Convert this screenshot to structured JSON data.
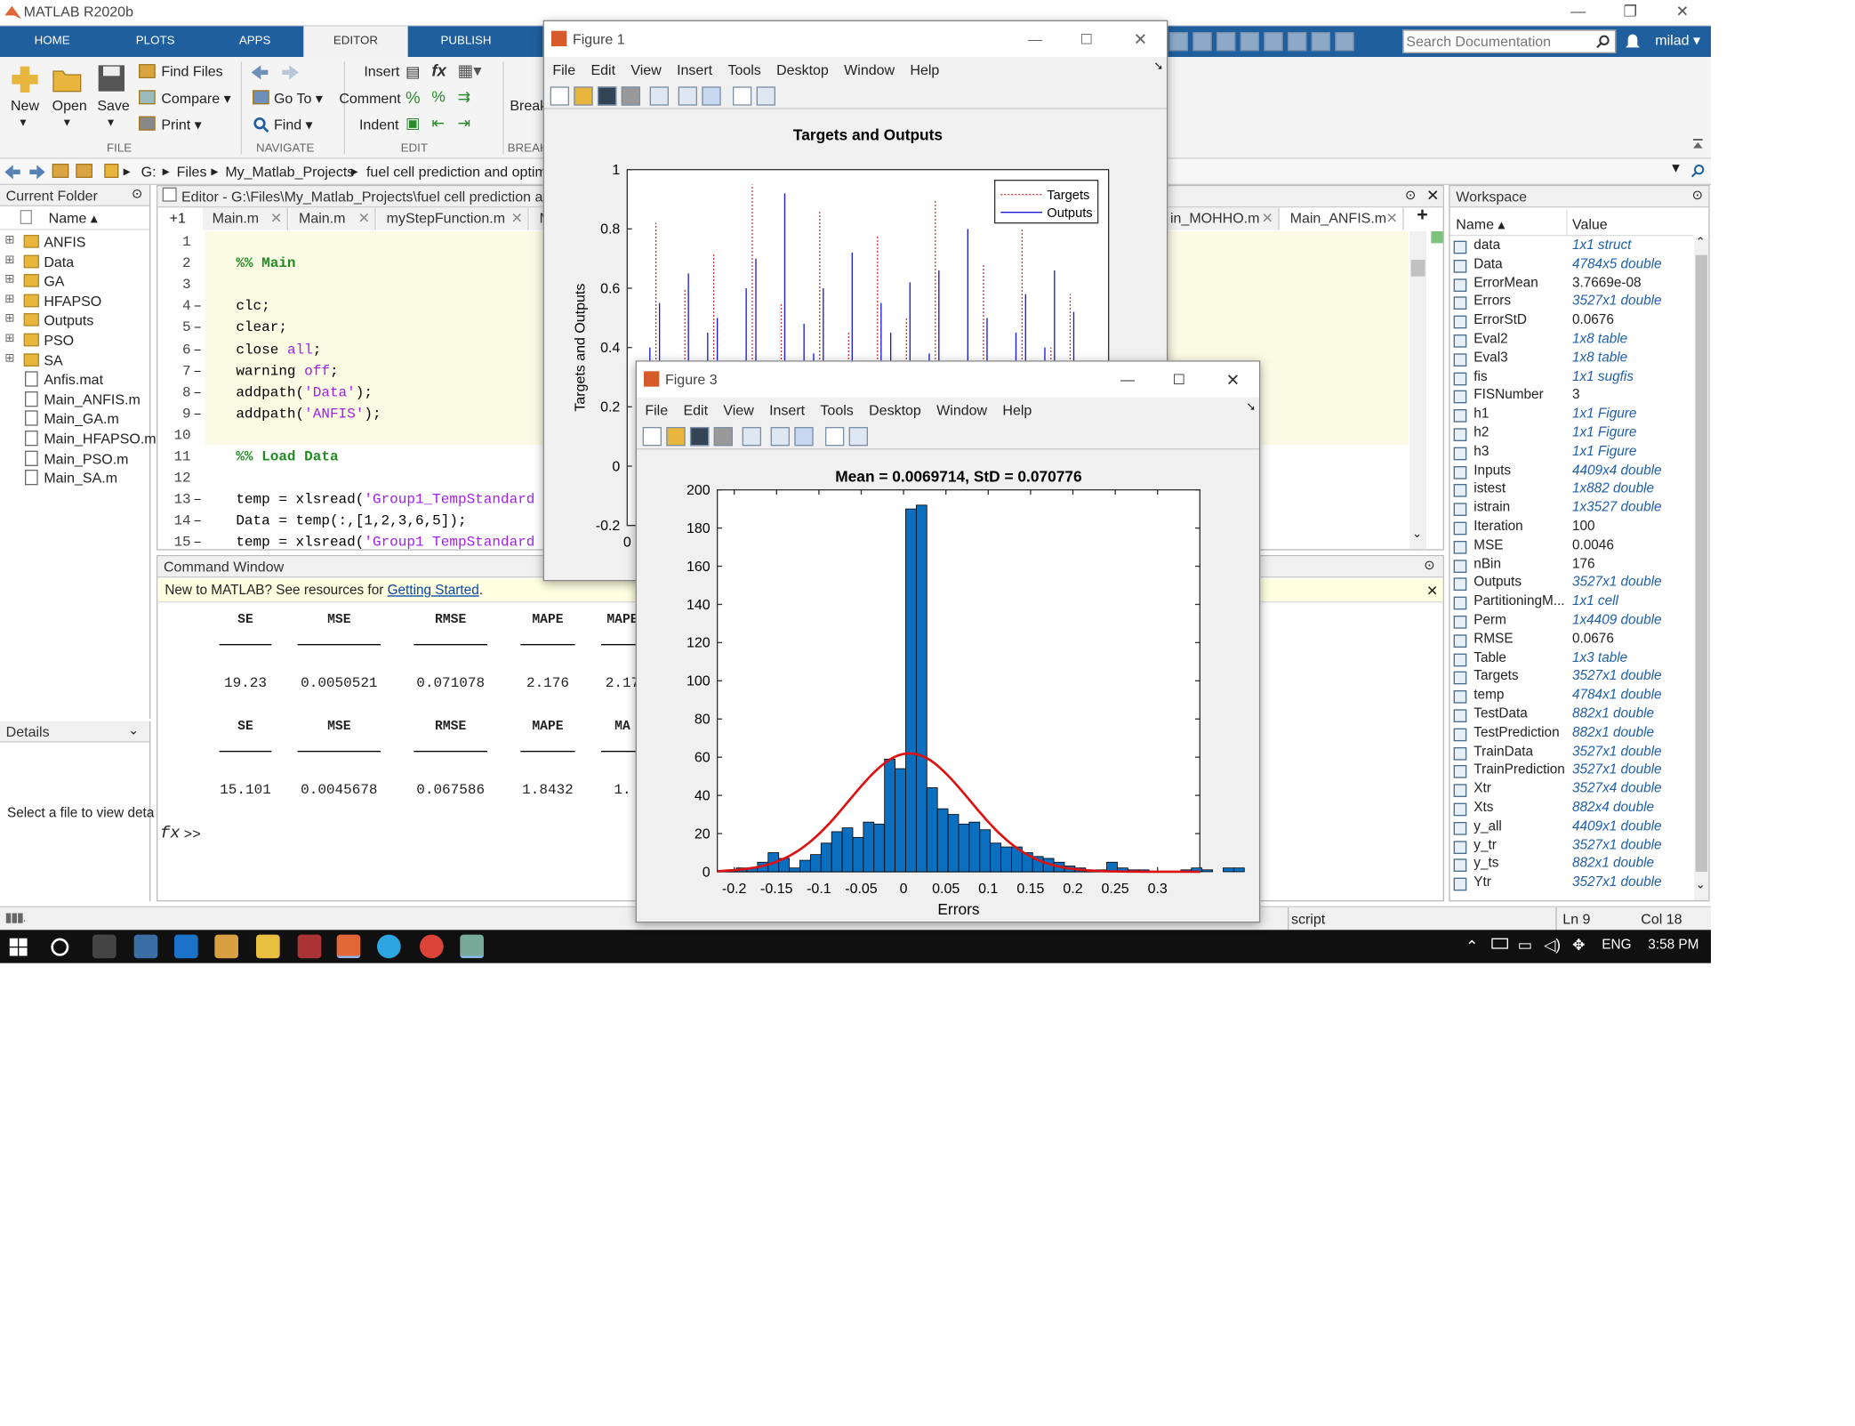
{
  "app": {
    "title": "MATLAB R2020b",
    "minimize": "—",
    "maximize": "❐",
    "close": "✕",
    "search_placeholder": "Search Documentation",
    "user": "milad ▾"
  },
  "ribbon": {
    "tabs": [
      "HOME",
      "PLOTS",
      "APPS",
      "EDITOR",
      "PUBLISH"
    ],
    "file": {
      "new": "New",
      "open": "Open",
      "save": "Save",
      "find_files": "Find Files",
      "compare": "Compare ▾",
      "print": "Print ▾",
      "label": "FILE"
    },
    "navigate": {
      "go_to": "Go To ▾",
      "find": "Find ▾",
      "label": "NAVIGATE"
    },
    "edit": {
      "insert": "Insert",
      "comment": "Comment",
      "indent": "Indent",
      "label": "EDIT"
    },
    "break": {
      "label": "Break",
      "section": "BREAK"
    }
  },
  "path": [
    "G:",
    "Files",
    "My_Matlab_Projects",
    "fuel cell prediction and optim"
  ],
  "current_folder": {
    "title": "Current Folder",
    "col": "Name ▴",
    "items": [
      {
        "name": "ANFIS",
        "type": "folder"
      },
      {
        "name": "Data",
        "type": "folder"
      },
      {
        "name": "GA",
        "type": "folder"
      },
      {
        "name": "HFAPSO",
        "type": "folder"
      },
      {
        "name": "Outputs",
        "type": "folder"
      },
      {
        "name": "PSO",
        "type": "folder"
      },
      {
        "name": "SA",
        "type": "folder"
      },
      {
        "name": "Anfis.mat",
        "type": "file"
      },
      {
        "name": "Main_ANFIS.m",
        "type": "file"
      },
      {
        "name": "Main_GA.m",
        "type": "file"
      },
      {
        "name": "Main_HFAPSO.m",
        "type": "file"
      },
      {
        "name": "Main_PSO.m",
        "type": "file"
      },
      {
        "name": "Main_SA.m",
        "type": "file"
      }
    ]
  },
  "details": {
    "title": "Details",
    "text": "Select a file to view deta"
  },
  "editor": {
    "title": "Editor - G:\\Files\\My_Matlab_Projects\\fuel cell prediction and o",
    "plus_one": "+1",
    "tabs": [
      "Main.m",
      "Main.m",
      "myStepFunction.m",
      "M"
    ],
    "right_tabs": [
      "in_MOHHO.m",
      "Main_ANFIS.m"
    ],
    "lines": [
      {
        "n": "1",
        "dash": "",
        "parts": [
          {
            "t": "",
            "c": ""
          }
        ]
      },
      {
        "n": "2",
        "dash": "",
        "parts": [
          {
            "t": "%% Main",
            "c": "cm"
          }
        ]
      },
      {
        "n": "3",
        "dash": "",
        "parts": [
          {
            "t": "",
            "c": ""
          }
        ]
      },
      {
        "n": "4",
        "dash": "–",
        "parts": [
          {
            "t": "clc;",
            "c": ""
          }
        ]
      },
      {
        "n": "5",
        "dash": "–",
        "parts": [
          {
            "t": "clear;",
            "c": ""
          }
        ]
      },
      {
        "n": "6",
        "dash": "–",
        "parts": [
          {
            "t": "close ",
            "c": ""
          },
          {
            "t": "all",
            "c": "str"
          },
          {
            "t": ";",
            "c": ""
          }
        ]
      },
      {
        "n": "7",
        "dash": "–",
        "parts": [
          {
            "t": "warning ",
            "c": ""
          },
          {
            "t": "off",
            "c": "str"
          },
          {
            "t": ";",
            "c": ""
          }
        ]
      },
      {
        "n": "8",
        "dash": "–",
        "parts": [
          {
            "t": "addpath(",
            "c": ""
          },
          {
            "t": "'Data'",
            "c": "str"
          },
          {
            "t": ");",
            "c": ""
          }
        ]
      },
      {
        "n": "9",
        "dash": "–",
        "parts": [
          {
            "t": "addpath(",
            "c": ""
          },
          {
            "t": "'ANFIS'",
            "c": "str"
          },
          {
            "t": ");",
            "c": ""
          }
        ]
      },
      {
        "n": "10",
        "dash": "",
        "parts": [
          {
            "t": "",
            "c": ""
          }
        ]
      },
      {
        "n": "11",
        "dash": "",
        "parts": [
          {
            "t": "%% Load Data",
            "c": "cm"
          }
        ]
      },
      {
        "n": "12",
        "dash": "",
        "parts": [
          {
            "t": "",
            "c": ""
          }
        ]
      },
      {
        "n": "13",
        "dash": "–",
        "parts": [
          {
            "t": "temp = xlsread(",
            "c": ""
          },
          {
            "t": "'Group1_TempStandard",
            "c": "str"
          }
        ]
      },
      {
        "n": "14",
        "dash": "–",
        "parts": [
          {
            "t": "Data = temp(:,[1,2,3,6,5]);",
            "c": ""
          }
        ]
      },
      {
        "n": "15",
        "dash": "–",
        "parts": [
          {
            "t": "temp = xlsread(",
            "c": ""
          },
          {
            "t": "'Group1 TempStandard",
            "c": "str"
          }
        ]
      }
    ]
  },
  "command": {
    "title": "Command Window",
    "banner": "New to MATLAB? See resources for ",
    "banner_link": "Getting Started",
    "banner_end": ".",
    "table1": {
      "headers": [
        "SE",
        "MSE",
        "RMSE",
        "MAPE",
        "MAPE"
      ],
      "values": [
        "19.23",
        "0.0050521",
        "0.071078",
        "2.176",
        "2.17"
      ]
    },
    "table2": {
      "headers": [
        "SE",
        "MSE",
        "RMSE",
        "MAPE",
        "MA"
      ],
      "values": [
        "15.101",
        "0.0045678",
        "0.067586",
        "1.8432",
        "1."
      ]
    },
    "prompt": ">>"
  },
  "workspace": {
    "title": "Workspace",
    "col_name": "Name ▴",
    "col_value": "Value",
    "vars": [
      {
        "n": "data",
        "v": "1x1 struct",
        "i": true
      },
      {
        "n": "Data",
        "v": "4784x5 double",
        "i": true
      },
      {
        "n": "ErrorMean",
        "v": "3.7669e-08",
        "i": false
      },
      {
        "n": "Errors",
        "v": "3527x1 double",
        "i": true
      },
      {
        "n": "ErrorStD",
        "v": "0.0676",
        "i": false
      },
      {
        "n": "Eval2",
        "v": "1x8 table",
        "i": true
      },
      {
        "n": "Eval3",
        "v": "1x8 table",
        "i": true
      },
      {
        "n": "fis",
        "v": "1x1 sugfis",
        "i": true
      },
      {
        "n": "FISNumber",
        "v": "3",
        "i": false
      },
      {
        "n": "h1",
        "v": "1x1 Figure",
        "i": true
      },
      {
        "n": "h2",
        "v": "1x1 Figure",
        "i": true
      },
      {
        "n": "h3",
        "v": "1x1 Figure",
        "i": true
      },
      {
        "n": "Inputs",
        "v": "4409x4 double",
        "i": true
      },
      {
        "n": "istest",
        "v": "1x882 double",
        "i": true
      },
      {
        "n": "istrain",
        "v": "1x3527 double",
        "i": true
      },
      {
        "n": "Iteration",
        "v": "100",
        "i": false
      },
      {
        "n": "MSE",
        "v": "0.0046",
        "i": false
      },
      {
        "n": "nBin",
        "v": "176",
        "i": false
      },
      {
        "n": "Outputs",
        "v": "3527x1 double",
        "i": true
      },
      {
        "n": "PartitioningM...",
        "v": "1x1 cell",
        "i": true
      },
      {
        "n": "Perm",
        "v": "1x4409 double",
        "i": true
      },
      {
        "n": "RMSE",
        "v": "0.0676",
        "i": false
      },
      {
        "n": "Table",
        "v": "1x3 table",
        "i": true
      },
      {
        "n": "Targets",
        "v": "3527x1 double",
        "i": true
      },
      {
        "n": "temp",
        "v": "4784x1 double",
        "i": true
      },
      {
        "n": "TestData",
        "v": "882x1 double",
        "i": true
      },
      {
        "n": "TestPrediction",
        "v": "882x1 double",
        "i": true
      },
      {
        "n": "TrainData",
        "v": "3527x1 double",
        "i": true
      },
      {
        "n": "TrainPrediction",
        "v": "3527x1 double",
        "i": true
      },
      {
        "n": "Xtr",
        "v": "3527x4 double",
        "i": true
      },
      {
        "n": "Xts",
        "v": "882x4 double",
        "i": true
      },
      {
        "n": "y_all",
        "v": "4409x1 double",
        "i": true
      },
      {
        "n": "y_tr",
        "v": "3527x1 double",
        "i": true
      },
      {
        "n": "y_ts",
        "v": "882x1 double",
        "i": true
      },
      {
        "n": "Ytr",
        "v": "3527x1 double",
        "i": true
      }
    ]
  },
  "status": {
    "mode": "script",
    "ln": "Ln  9",
    "col": "Col  18"
  },
  "taskbar": {
    "lang": "ENG",
    "time": "3:58 PM"
  },
  "figure1": {
    "title": "Figure 1",
    "menus": [
      "File",
      "Edit",
      "View",
      "Insert",
      "Tools",
      "Desktop",
      "Window",
      "Help"
    ]
  },
  "figure3": {
    "title": "Figure 3",
    "menus": [
      "File",
      "Edit",
      "View",
      "Insert",
      "Tools",
      "Desktop",
      "Window",
      "Help"
    ]
  },
  "chart_data": [
    {
      "type": "line",
      "title": "Targets and Outputs",
      "ylabel": "Targets and Outputs",
      "xlabel": "",
      "ylim": [
        -0.2,
        1
      ],
      "yticks": [
        "1",
        "0.8",
        "0.6",
        "0.4",
        "0.2",
        "0",
        "-0.2"
      ],
      "xticks": [
        "0"
      ],
      "legend": {
        "placement": "top-right",
        "entries": [
          "Targets",
          "Outputs"
        ]
      },
      "series": [
        {
          "name": "Targets",
          "style": "dotted",
          "color": "#d23c3c",
          "values": [
            0.05,
            0.15,
            0.82,
            0.05,
            0.1,
            0.6,
            0.05,
            0.12,
            0.72,
            0.08,
            0.05,
            0.18,
            0.95,
            0.06,
            0.1,
            0.55,
            0.05,
            0.12,
            0.3,
            0.86,
            0.05,
            0.07,
            0.45,
            0.1,
            0.05,
            0.78,
            0.15,
            0.06,
            0.5,
            0.05,
            0.12,
            0.9,
            0.06,
            0.08,
            0.35,
            0.05,
            0.68,
            0.1,
            0.05,
            0.22,
            0.8,
            0.06,
            0.12,
            0.4,
            0.05,
            0.58,
            0.08,
            0.05
          ]
        },
        {
          "name": "Outputs",
          "style": "solid",
          "color": "#1a1ad6",
          "values": [
            0.06,
            0.4,
            0.55,
            0.08,
            0.3,
            0.65,
            0.06,
            0.45,
            0.5,
            0.1,
            0.25,
            0.6,
            0.7,
            0.08,
            0.35,
            0.92,
            0.06,
            0.48,
            0.38,
            0.6,
            0.07,
            0.3,
            0.72,
            0.1,
            0.2,
            0.55,
            0.45,
            0.05,
            0.62,
            0.08,
            0.38,
            0.66,
            0.06,
            0.28,
            0.8,
            0.05,
            0.5,
            0.32,
            0.06,
            0.45,
            0.58,
            0.07,
            0.4,
            0.66,
            0.05,
            0.52,
            0.3,
            0.06
          ]
        }
      ]
    },
    {
      "type": "bar",
      "title": "Mean = 0.0069714, StD = 0.070776",
      "xlabel": "Errors",
      "ylabel": "",
      "xlim": [
        -0.22,
        0.35
      ],
      "ylim": [
        0,
        200
      ],
      "xticks": [
        "-0.2",
        "-0.15",
        "-0.1",
        "-0.05",
        "0",
        "0.05",
        "0.1",
        "0.15",
        "0.2",
        "0.25",
        "0.3"
      ],
      "yticks": [
        "0",
        "20",
        "40",
        "60",
        "80",
        "100",
        "120",
        "140",
        "160",
        "180",
        "200"
      ],
      "bin_width": 0.0125,
      "bin_start": -0.21,
      "values": [
        1,
        2,
        2,
        5,
        10,
        7,
        2,
        6,
        9,
        15,
        21,
        23,
        18,
        26,
        25,
        59,
        54,
        190,
        192,
        44,
        33,
        30,
        25,
        26,
        22,
        15,
        13,
        13,
        10,
        8,
        7,
        5,
        3,
        2,
        1,
        1,
        5,
        2,
        1,
        1,
        0,
        0,
        0,
        1,
        2,
        1,
        0,
        2,
        2
      ],
      "fit_curve": {
        "color": "#dd1111",
        "mean": 0.0069714,
        "std": 0.070776,
        "peak": 62
      }
    }
  ]
}
